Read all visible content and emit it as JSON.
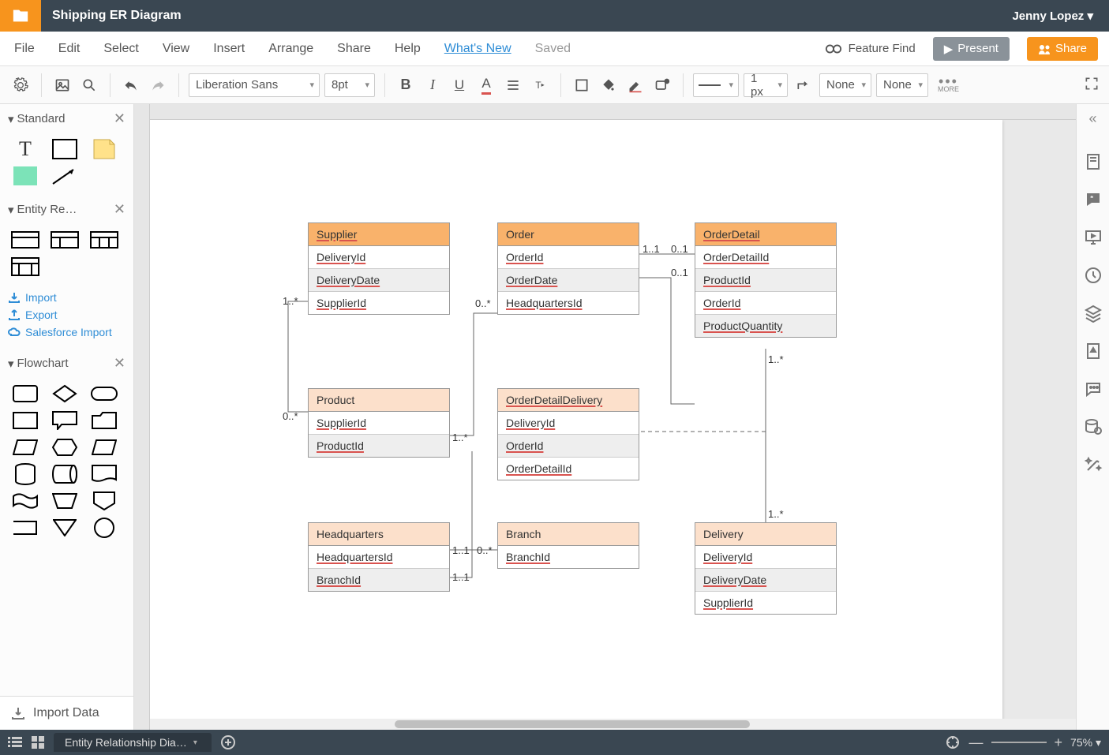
{
  "app": {
    "document_title": "Shipping ER Diagram",
    "user_name": "Jenny Lopez"
  },
  "menu": {
    "items": [
      "File",
      "Edit",
      "Select",
      "View",
      "Insert",
      "Arrange",
      "Share",
      "Help"
    ],
    "whats_new": "What's New",
    "saved": "Saved",
    "feature_find": "Feature Find",
    "present": "Present",
    "share": "Share"
  },
  "toolbar": {
    "font_family": "Liberation Sans",
    "font_size": "8pt",
    "line_width": "1 px",
    "fill_label_1": "None",
    "fill_label_2": "None",
    "more_label": "MORE"
  },
  "left": {
    "sections": {
      "standard": "Standard",
      "entity": "Entity Re…",
      "flowchart": "Flowchart"
    },
    "links": {
      "import": "Import",
      "export": "Export",
      "salesforce": "Salesforce Import"
    },
    "import_data": "Import Data"
  },
  "canvas": {
    "entities": {
      "supplier": {
        "title": "Supplier",
        "fields": [
          "DeliveryId",
          "DeliveryDate",
          "SupplierId"
        ]
      },
      "order": {
        "title": "Order",
        "fields": [
          "OrderId",
          "OrderDate",
          "HeadquartersId"
        ]
      },
      "orderDetail": {
        "title": "OrderDetail",
        "fields": [
          "OrderDetailId",
          "ProductId",
          "OrderId",
          "ProductQuantity"
        ]
      },
      "product": {
        "title": "Product",
        "fields": [
          "SupplierId",
          "ProductId"
        ]
      },
      "orderDetailDelivery": {
        "title": "OrderDetailDelivery",
        "fields": [
          "DeliveryId",
          "OrderId",
          "OrderDetailId"
        ]
      },
      "headquarters": {
        "title": "Headquarters",
        "fields": [
          "HeadquartersId",
          "BranchId"
        ]
      },
      "branch": {
        "title": "Branch",
        "fields": [
          "BranchId"
        ]
      },
      "delivery": {
        "title": "Delivery",
        "fields": [
          "DeliveryId",
          "DeliveryDate",
          "SupplierId"
        ]
      }
    },
    "cardinalities": {
      "c1": "1..*",
      "c2": "0..*",
      "c3": "1..1",
      "c4": "0..1",
      "c5": "0..1",
      "c6": "1..*",
      "c7": "0..*",
      "c8": "1..1",
      "c9": "0..*",
      "c10": "1..1",
      "c11": "1..*",
      "c12": "1..*"
    }
  },
  "bottom": {
    "tab_name": "Entity Relationship Dia…",
    "zoom": "75%"
  }
}
